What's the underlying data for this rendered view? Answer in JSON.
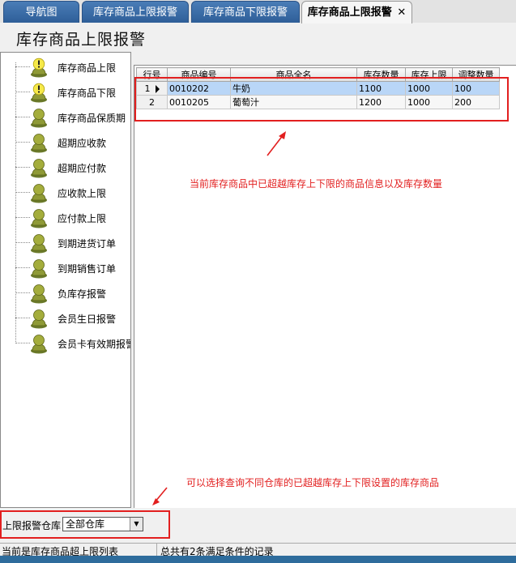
{
  "tabs": [
    {
      "label": "导航图",
      "active": false
    },
    {
      "label": "库存商品上限报警",
      "active": false
    },
    {
      "label": "库存商品下限报警",
      "active": false
    },
    {
      "label": "库存商品上限报警",
      "active": true,
      "close": "✕"
    }
  ],
  "page_title": "库存商品上限报警",
  "tree": {
    "items": [
      {
        "label": "库存商品上限",
        "icon": "warning-person-icon"
      },
      {
        "label": "库存商品下限",
        "icon": "warning-person-icon"
      },
      {
        "label": "库存商品保质期",
        "icon": "person-icon"
      },
      {
        "label": "超期应收款",
        "icon": "person-icon"
      },
      {
        "label": "超期应付款",
        "icon": "person-icon"
      },
      {
        "label": "应收款上限",
        "icon": "person-icon"
      },
      {
        "label": "应付款上限",
        "icon": "person-icon"
      },
      {
        "label": "到期进货订单",
        "icon": "person-icon"
      },
      {
        "label": "到期销售订单",
        "icon": "person-icon"
      },
      {
        "label": "负库存报警",
        "icon": "person-icon"
      },
      {
        "label": "会员生日报警",
        "icon": "person-icon"
      },
      {
        "label": "会员卡有效期报警",
        "icon": "person-icon"
      }
    ],
    "scroll_left": "◀",
    "scroll_right": "▶"
  },
  "grid": {
    "columns": [
      "行号",
      "商品编号",
      "商品全名",
      "库存数量",
      "库存上限",
      "调整数量"
    ],
    "rows": [
      {
        "no": "1",
        "code": "0010202",
        "name": "牛奶",
        "qty": "1100",
        "limit": "1000",
        "adjust": "100",
        "selected": true
      },
      {
        "no": "2",
        "code": "0010205",
        "name": "葡萄汁",
        "qty": "1200",
        "limit": "1000",
        "adjust": "200",
        "selected": false
      }
    ]
  },
  "annotations": {
    "grid_note": "当前库存商品中已超越库存上下限的商品信息以及库存数量",
    "filter_note": "可以选择查询不同仓库的已超越库存上下限设置的库存商品"
  },
  "filter": {
    "label": "上限报警仓库",
    "value": "全部仓库"
  },
  "status": {
    "left": "当前是库存商品超上限列表",
    "right": "总共有2条满足条件的记录"
  },
  "colors": {
    "tab_blue": "#3a6ea8",
    "selected_row": "#b9d6f7",
    "annotation_red": "#e21f1f",
    "bottom_strip": "#2e6c9c"
  }
}
